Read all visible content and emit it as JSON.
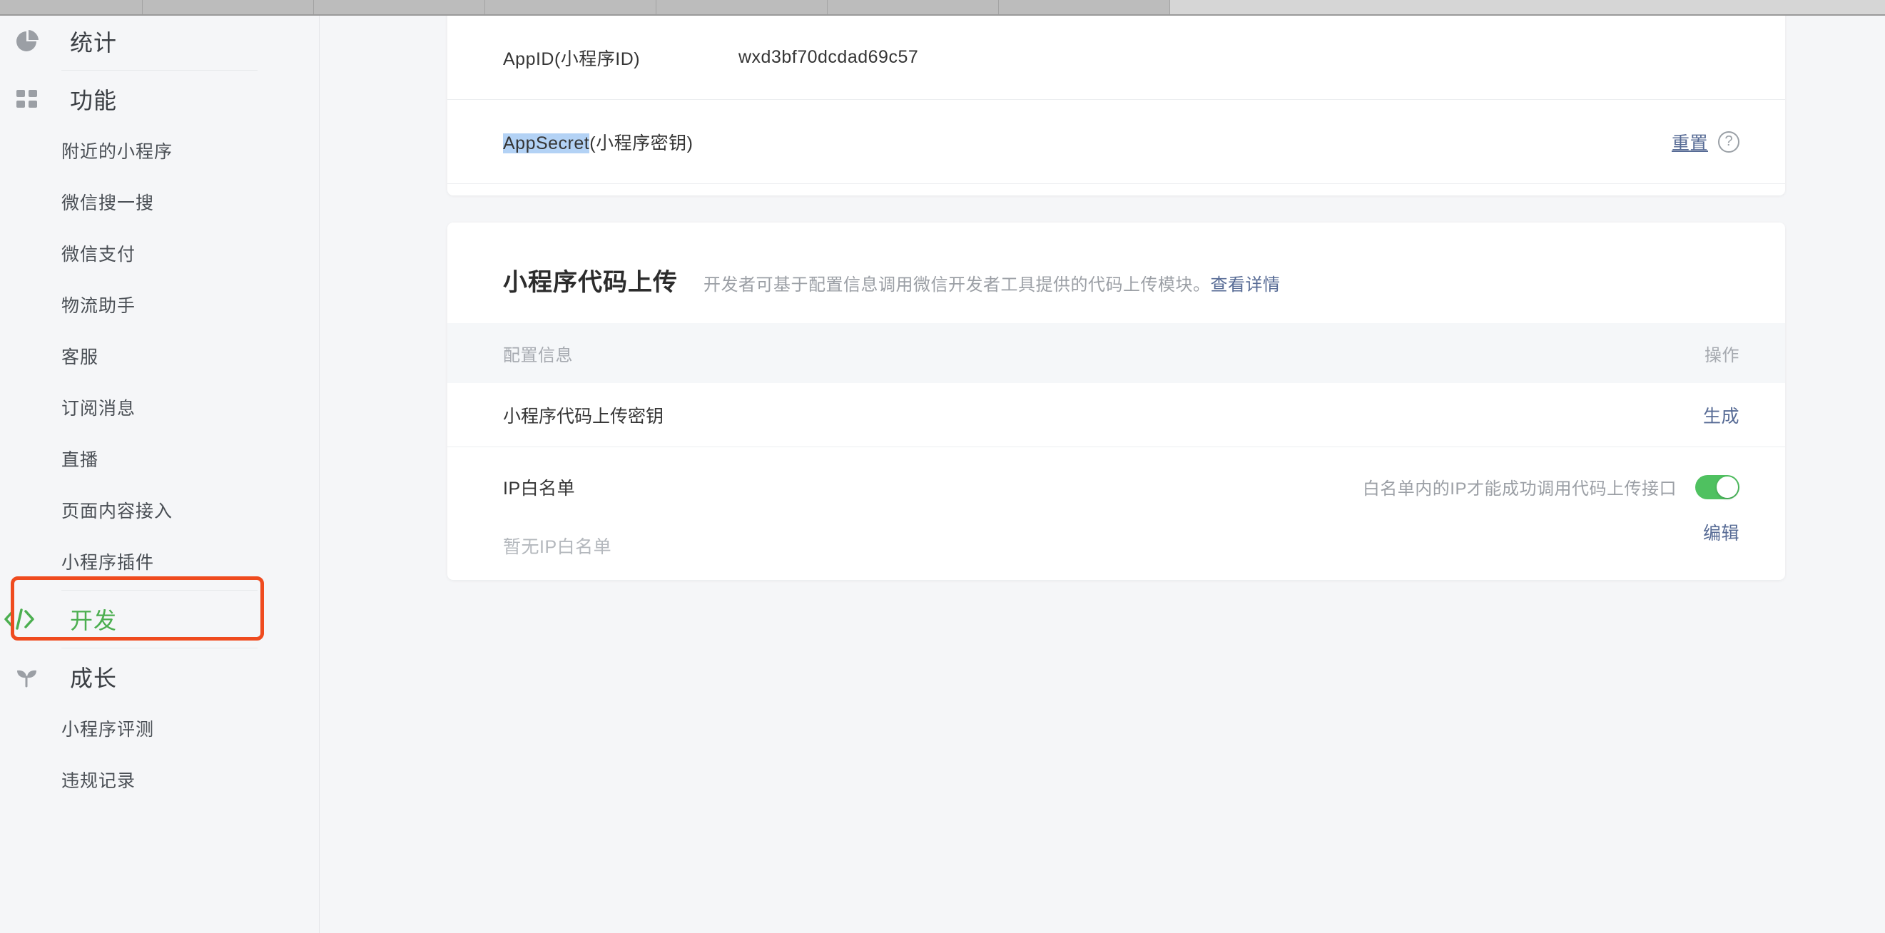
{
  "browser": {
    "tab_widths": [
      200,
      240,
      240,
      240,
      240,
      240,
      240
    ]
  },
  "sidebar": {
    "groups": [
      {
        "id": "stats",
        "icon": "pie-chart-icon",
        "label": "统计",
        "active": false,
        "items": []
      },
      {
        "id": "function",
        "icon": "grid-icon",
        "label": "功能",
        "active": false,
        "items": [
          "附近的小程序",
          "微信搜一搜",
          "微信支付",
          "物流助手",
          "客服",
          "订阅消息",
          "直播",
          "页面内容接入",
          "小程序插件"
        ]
      },
      {
        "id": "develop",
        "icon": "code-icon",
        "label": "开发",
        "active": true,
        "highlighted": true,
        "items": []
      },
      {
        "id": "growth",
        "icon": "sprout-icon",
        "label": "成长",
        "active": false,
        "items": [
          "小程序评测",
          "违规记录"
        ]
      }
    ],
    "highlight_color": "#ef4b1f",
    "active_color": "#4caf50"
  },
  "main": {
    "basic_card": {
      "rows": [
        {
          "label": "AppID(小程序ID)",
          "value": "wxd3bf70dcdad69c57",
          "selected_part": "",
          "actions": []
        },
        {
          "label_selected": "AppSecret",
          "label_rest": "(小程序密钥)",
          "value": "",
          "actions": [
            {
              "name": "reset-link",
              "label": "重置"
            },
            {
              "name": "help-icon",
              "label": "?"
            }
          ]
        }
      ]
    },
    "upload_card": {
      "title": "小程序代码上传",
      "description": "开发者可基于配置信息调用微信开发者工具提供的代码上传模块。",
      "description_link": "查看详情",
      "table": {
        "headers": {
          "config": "配置信息",
          "action": "操作"
        },
        "rows": [
          {
            "type": "key",
            "title": "小程序代码上传密钥",
            "action_label": "生成"
          },
          {
            "type": "ip",
            "title": "IP白名单",
            "empty_text": "暂无IP白名单",
            "hint": "白名单内的IP才能成功调用代码上传接口",
            "toggle_on": true,
            "toggle_color": "#4fc160",
            "action_label": "编辑"
          }
        ]
      }
    }
  },
  "colors": {
    "link": "#576b95",
    "page_bg": "#f5f6f8",
    "card_bg": "#ffffff",
    "selection": "#b3d2f5"
  }
}
